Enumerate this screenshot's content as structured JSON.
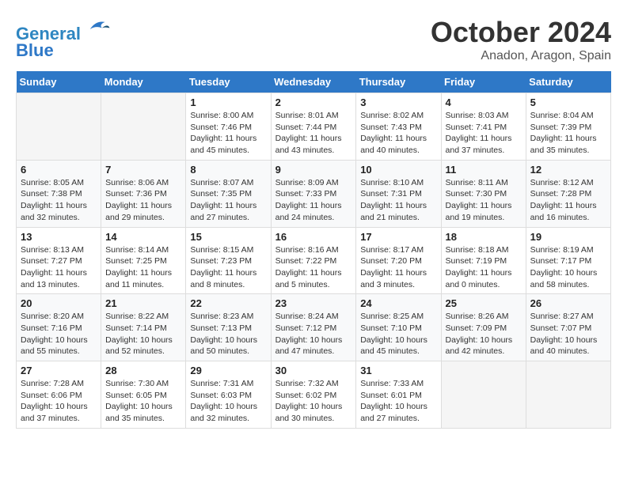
{
  "header": {
    "logo_line1": "General",
    "logo_line2": "Blue",
    "month_title": "October 2024",
    "subtitle": "Anadon, Aragon, Spain"
  },
  "weekdays": [
    "Sunday",
    "Monday",
    "Tuesday",
    "Wednesday",
    "Thursday",
    "Friday",
    "Saturday"
  ],
  "weeks": [
    [
      {
        "day": "",
        "info": ""
      },
      {
        "day": "",
        "info": ""
      },
      {
        "day": "1",
        "info": "Sunrise: 8:00 AM\nSunset: 7:46 PM\nDaylight: 11 hours and 45 minutes."
      },
      {
        "day": "2",
        "info": "Sunrise: 8:01 AM\nSunset: 7:44 PM\nDaylight: 11 hours and 43 minutes."
      },
      {
        "day": "3",
        "info": "Sunrise: 8:02 AM\nSunset: 7:43 PM\nDaylight: 11 hours and 40 minutes."
      },
      {
        "day": "4",
        "info": "Sunrise: 8:03 AM\nSunset: 7:41 PM\nDaylight: 11 hours and 37 minutes."
      },
      {
        "day": "5",
        "info": "Sunrise: 8:04 AM\nSunset: 7:39 PM\nDaylight: 11 hours and 35 minutes."
      }
    ],
    [
      {
        "day": "6",
        "info": "Sunrise: 8:05 AM\nSunset: 7:38 PM\nDaylight: 11 hours and 32 minutes."
      },
      {
        "day": "7",
        "info": "Sunrise: 8:06 AM\nSunset: 7:36 PM\nDaylight: 11 hours and 29 minutes."
      },
      {
        "day": "8",
        "info": "Sunrise: 8:07 AM\nSunset: 7:35 PM\nDaylight: 11 hours and 27 minutes."
      },
      {
        "day": "9",
        "info": "Sunrise: 8:09 AM\nSunset: 7:33 PM\nDaylight: 11 hours and 24 minutes."
      },
      {
        "day": "10",
        "info": "Sunrise: 8:10 AM\nSunset: 7:31 PM\nDaylight: 11 hours and 21 minutes."
      },
      {
        "day": "11",
        "info": "Sunrise: 8:11 AM\nSunset: 7:30 PM\nDaylight: 11 hours and 19 minutes."
      },
      {
        "day": "12",
        "info": "Sunrise: 8:12 AM\nSunset: 7:28 PM\nDaylight: 11 hours and 16 minutes."
      }
    ],
    [
      {
        "day": "13",
        "info": "Sunrise: 8:13 AM\nSunset: 7:27 PM\nDaylight: 11 hours and 13 minutes."
      },
      {
        "day": "14",
        "info": "Sunrise: 8:14 AM\nSunset: 7:25 PM\nDaylight: 11 hours and 11 minutes."
      },
      {
        "day": "15",
        "info": "Sunrise: 8:15 AM\nSunset: 7:23 PM\nDaylight: 11 hours and 8 minutes."
      },
      {
        "day": "16",
        "info": "Sunrise: 8:16 AM\nSunset: 7:22 PM\nDaylight: 11 hours and 5 minutes."
      },
      {
        "day": "17",
        "info": "Sunrise: 8:17 AM\nSunset: 7:20 PM\nDaylight: 11 hours and 3 minutes."
      },
      {
        "day": "18",
        "info": "Sunrise: 8:18 AM\nSunset: 7:19 PM\nDaylight: 11 hours and 0 minutes."
      },
      {
        "day": "19",
        "info": "Sunrise: 8:19 AM\nSunset: 7:17 PM\nDaylight: 10 hours and 58 minutes."
      }
    ],
    [
      {
        "day": "20",
        "info": "Sunrise: 8:20 AM\nSunset: 7:16 PM\nDaylight: 10 hours and 55 minutes."
      },
      {
        "day": "21",
        "info": "Sunrise: 8:22 AM\nSunset: 7:14 PM\nDaylight: 10 hours and 52 minutes."
      },
      {
        "day": "22",
        "info": "Sunrise: 8:23 AM\nSunset: 7:13 PM\nDaylight: 10 hours and 50 minutes."
      },
      {
        "day": "23",
        "info": "Sunrise: 8:24 AM\nSunset: 7:12 PM\nDaylight: 10 hours and 47 minutes."
      },
      {
        "day": "24",
        "info": "Sunrise: 8:25 AM\nSunset: 7:10 PM\nDaylight: 10 hours and 45 minutes."
      },
      {
        "day": "25",
        "info": "Sunrise: 8:26 AM\nSunset: 7:09 PM\nDaylight: 10 hours and 42 minutes."
      },
      {
        "day": "26",
        "info": "Sunrise: 8:27 AM\nSunset: 7:07 PM\nDaylight: 10 hours and 40 minutes."
      }
    ],
    [
      {
        "day": "27",
        "info": "Sunrise: 7:28 AM\nSunset: 6:06 PM\nDaylight: 10 hours and 37 minutes."
      },
      {
        "day": "28",
        "info": "Sunrise: 7:30 AM\nSunset: 6:05 PM\nDaylight: 10 hours and 35 minutes."
      },
      {
        "day": "29",
        "info": "Sunrise: 7:31 AM\nSunset: 6:03 PM\nDaylight: 10 hours and 32 minutes."
      },
      {
        "day": "30",
        "info": "Sunrise: 7:32 AM\nSunset: 6:02 PM\nDaylight: 10 hours and 30 minutes."
      },
      {
        "day": "31",
        "info": "Sunrise: 7:33 AM\nSunset: 6:01 PM\nDaylight: 10 hours and 27 minutes."
      },
      {
        "day": "",
        "info": ""
      },
      {
        "day": "",
        "info": ""
      }
    ]
  ]
}
